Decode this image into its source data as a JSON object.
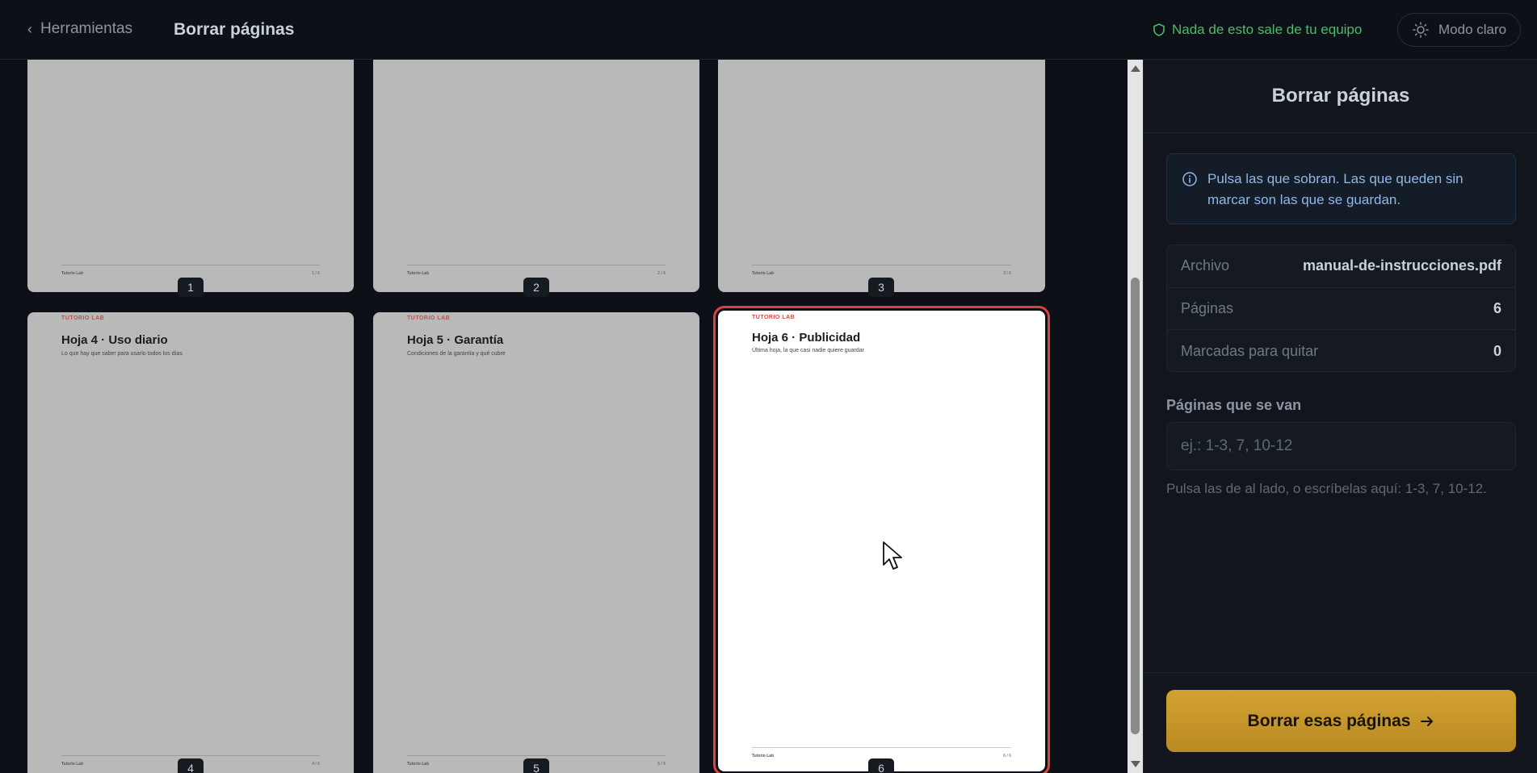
{
  "header": {
    "back_label": "Herramientas",
    "title": "Borrar páginas",
    "privacy_text": "Nada de esto sale de tu equipo",
    "theme_label": "Modo claro"
  },
  "pages": [
    {
      "num": "1",
      "brand": "",
      "title": "",
      "subtitle": "",
      "footer_left": "Tutorio Lab",
      "footer_right": "1 / 6",
      "selected": false
    },
    {
      "num": "2",
      "brand": "",
      "title": "",
      "subtitle": "",
      "footer_left": "Tutorio Lab",
      "footer_right": "2 / 6",
      "selected": false
    },
    {
      "num": "3",
      "brand": "",
      "title": "",
      "subtitle": "",
      "footer_left": "Tutorio Lab",
      "footer_right": "3 / 6",
      "selected": false
    },
    {
      "num": "4",
      "brand": "TUTORIO LAB",
      "title": "Hoja 4 · Uso diario",
      "subtitle": "Lo que hay que saber para usarlo todos los días",
      "footer_left": "Tutorio Lab",
      "footer_right": "4 / 6",
      "selected": false
    },
    {
      "num": "5",
      "brand": "TUTORIO LAB",
      "title": "Hoja 5 · Garantía",
      "subtitle": "Condiciones de la garantía y qué cubre",
      "footer_left": "Tutorio Lab",
      "footer_right": "5 / 6",
      "selected": false
    },
    {
      "num": "6",
      "brand": "TUTORIO LAB",
      "title": "Hoja 6 · Publicidad",
      "subtitle": "Última hoja, la que casi nadie quiere guardar",
      "footer_left": "Tutorio Lab",
      "footer_right": "6 / 6",
      "selected": true
    }
  ],
  "panel": {
    "title": "Borrar páginas",
    "info": "Pulsa las que sobran. Las que queden sin marcar son las que se guardan.",
    "stats": {
      "file_label": "Archivo",
      "file_value": "manual-de-instrucciones.pdf",
      "pages_label": "Páginas",
      "pages_value": "6",
      "marked_label": "Marcadas para quitar",
      "marked_value": "0"
    },
    "input_label": "Páginas que se van",
    "input_placeholder": "ej.: 1-3, 7, 10-12",
    "input_value": "",
    "hint": "Pulsa las de al lado, o escríbelas aquí: 1-3, 7, 10-12.",
    "action_label": "Borrar esas páginas"
  },
  "colors": {
    "accent": "#c8961f",
    "privacy": "#4cbb6b",
    "selection": "#d9443b",
    "info_text": "#8fb8e6"
  }
}
